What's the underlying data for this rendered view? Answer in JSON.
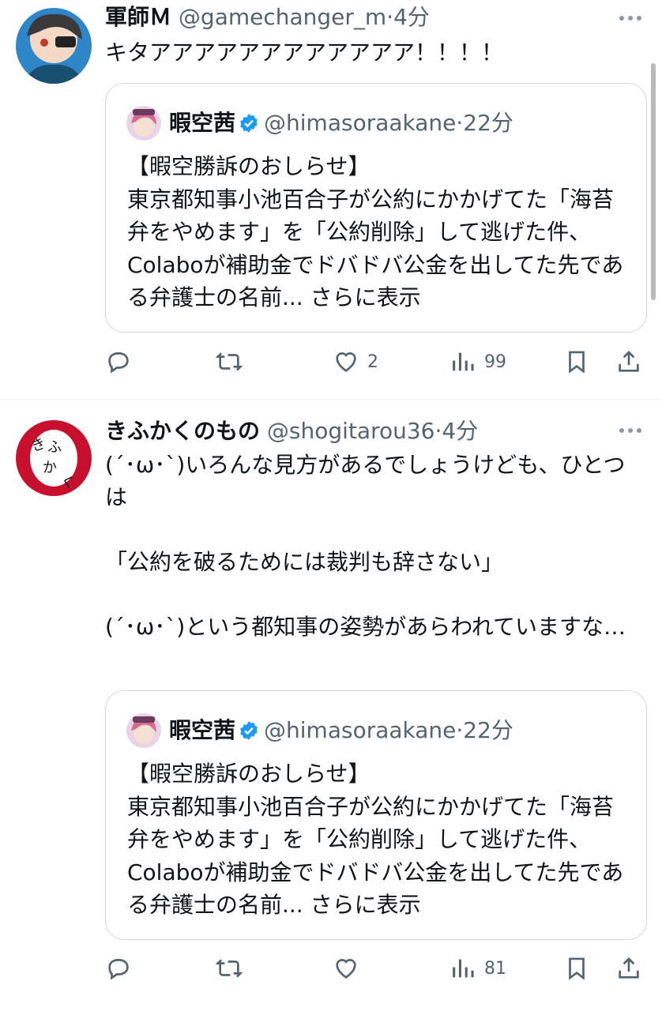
{
  "tweets": [
    {
      "name": "軍師Ｍ",
      "handle": "@gamechanger_m",
      "dot": "·",
      "time": "4分",
      "text": "キタアアアアアアアアアアアア！！！！",
      "quote": {
        "name": "暇空茜",
        "handle": "@himasoraakane",
        "dot": "·",
        "time": "22分",
        "text": "【暇空勝訴のおしらせ】\n東京都知事小池百合子が公約にかかげてた「海苔弁をやめます」を「公約削除」して逃げた件、Colaboが補助金でドバドバ公金を出してた先である弁護士の名前...",
        "more": "さらに表示"
      },
      "actions": {
        "likes": "2",
        "views": "99"
      }
    },
    {
      "name": "きふかくのもの",
      "handle": "@shogitarou36",
      "dot": "·",
      "time": "4分",
      "text": "(´･ω･`)いろんな見方があるでしょうけども、ひとつは\n\n「公約を破るためには裁判も辞さない」\n\n(´･ω･`)という都知事の姿勢があらわれていますな…",
      "avatar_text": "きふかく",
      "quote": {
        "name": "暇空茜",
        "handle": "@himasoraakane",
        "dot": "·",
        "time": "22分",
        "text": "【暇空勝訴のおしらせ】\n東京都知事小池百合子が公約にかかげてた「海苔弁をやめます」を「公約削除」して逃げた件、Colaboが補助金でドバドバ公金を出してた先である弁護士の名前...",
        "more": "さらに表示"
      },
      "actions": {
        "likes": "",
        "views": "81"
      }
    }
  ],
  "icons": [
    "reply-icon",
    "retweet-icon",
    "like-icon",
    "views-icon",
    "bookmark-icon",
    "share-icon",
    "verified-icon",
    "more-icon"
  ],
  "colors": {
    "accent": "#1d9bf0",
    "muted": "#536471",
    "border": "#cfd9de",
    "avatar2_bg": "#c8102e"
  }
}
